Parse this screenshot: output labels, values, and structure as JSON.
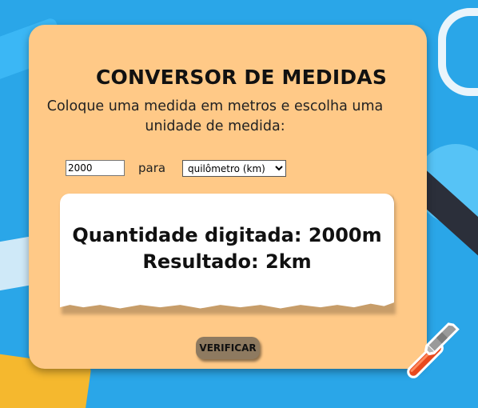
{
  "converter": {
    "title": "CONVERSOR DE MEDIDAS",
    "instructions": "Coloque uma medida em metros e escolha uma unidade de medida:",
    "input": {
      "value": "2000",
      "placeholder": ""
    },
    "para_label": "para",
    "unit_select": {
      "selected": "quilômetro (km)"
    },
    "result": {
      "line1": "Quantidade digitada: 2000m",
      "line2": "Resultado: 2km"
    },
    "verify_button": "VERIFICAR"
  },
  "colors": {
    "card_background": "#ffc987",
    "page_background": "#2aa6e8",
    "button_background": "#8e7a60",
    "hammer_handle": "#e8491d",
    "hammer_head": "#9a9a9a"
  },
  "icons": {
    "decorative": "hammer-icon"
  }
}
